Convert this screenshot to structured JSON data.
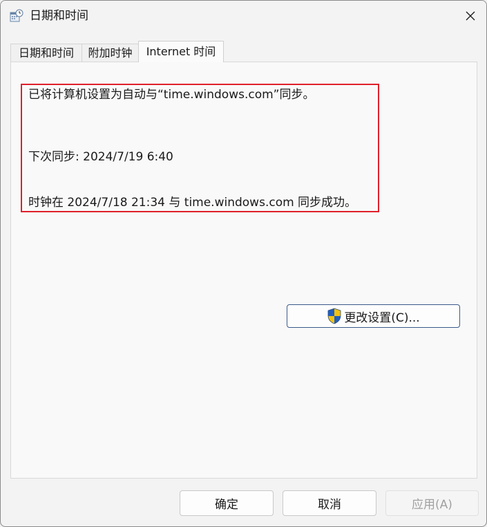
{
  "window": {
    "title": "日期和时间"
  },
  "tabs": [
    {
      "label": "日期和时间",
      "active": false
    },
    {
      "label": "附加时钟",
      "active": false
    },
    {
      "label": "Internet 时间",
      "active": true
    }
  ],
  "internet_time": {
    "sync_configured": "已将计算机设置为自动与“time.windows.com”同步。",
    "next_sync": "下次同步: 2024/7/19 6:40",
    "last_sync": "时钟在 2024/7/18 21:34 与 time.windows.com 同步成功。",
    "change_settings_label": "更改设置(C)...",
    "change_settings_icon": "uac-shield-icon"
  },
  "footer": {
    "ok_label": "确定",
    "cancel_label": "取消",
    "apply_label": "应用(A)",
    "apply_enabled": false
  },
  "colors": {
    "highlight_border": "#e0202b",
    "accent_border": "#3a5a8a"
  }
}
